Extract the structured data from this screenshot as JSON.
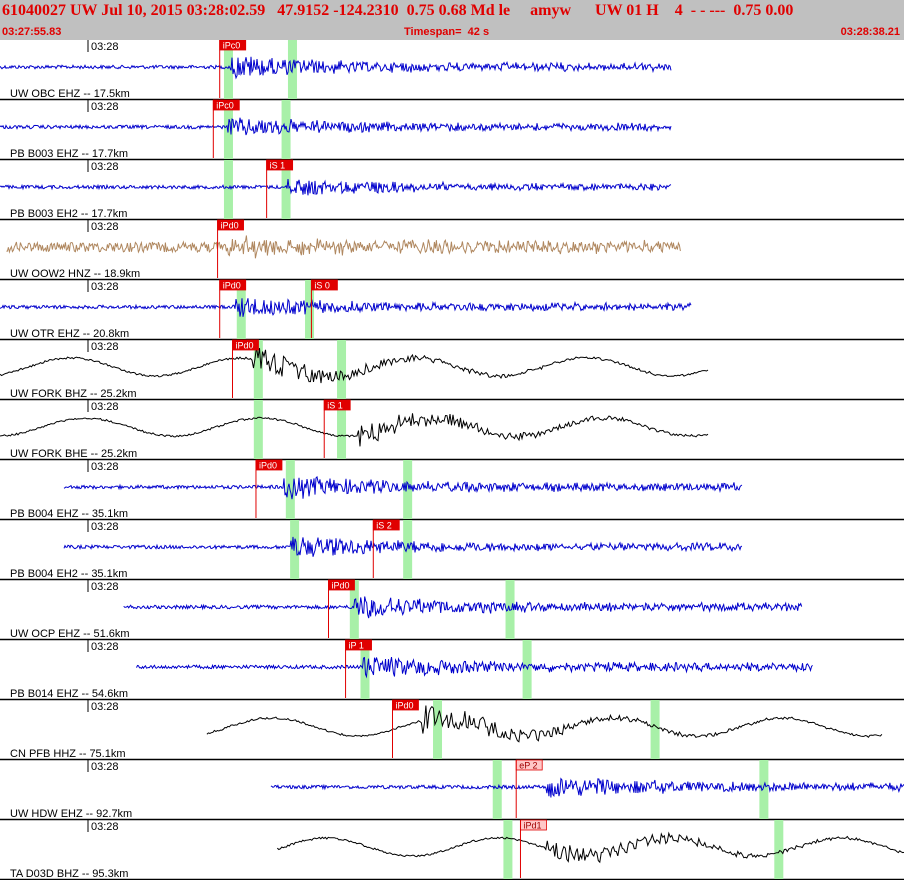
{
  "header": {
    "title": "61040027 UW Jul 10, 2015 03:28:02.59   47.9152 -124.2310  0.75 0.68 Md le     amyw      UW 01 H    4  - - ---  0.75 0.00",
    "start_time": "03:27:55.83",
    "timespan": "Timespan=  42 s",
    "end_time": "03:28:38.21"
  },
  "colors": {
    "header_bg": "#c0c0c0",
    "header_text": "#e00000",
    "blue_trace": "#0000cc",
    "tan_trace": "#b08860",
    "black_trace": "#000000",
    "pick": "#e00000",
    "pick_weak": "#ffc8c8",
    "window": "#a8f0a8"
  },
  "chart_data": {
    "type": "seismogram",
    "x_start": "03:27:55.83",
    "x_end": "03:28:38.21",
    "timespan_s": 42,
    "channels": [
      {
        "label": "UW OBC EHZ -- 17.5km",
        "time_label": "03:28",
        "color": "blue",
        "start_s": 0.0,
        "end_s": 31.5,
        "amp": 0.45,
        "picks": [
          {
            "label": "iPc0",
            "t": 10.3
          }
        ],
        "windows": [
          {
            "t": 10.5
          },
          {
            "t": 13.5
          }
        ],
        "onset_s": 10.8
      },
      {
        "label": "PB B003 EHZ -- 17.7km",
        "time_label": "03:28",
        "color": "blue",
        "start_s": 0.0,
        "end_s": 31.5,
        "amp": 0.4,
        "picks": [
          {
            "label": "iPc0",
            "t": 10.0
          }
        ],
        "windows": [
          {
            "t": 10.5
          },
          {
            "t": 13.2
          }
        ],
        "onset_s": 10.6
      },
      {
        "label": "PB B003 EH2 -- 17.7km",
        "time_label": "03:28",
        "color": "blue",
        "start_s": 0.0,
        "end_s": 31.5,
        "amp": 0.35,
        "picks": [
          {
            "label": "iS 1",
            "t": 12.5
          }
        ],
        "windows": [
          {
            "t": 10.5
          },
          {
            "t": 13.2
          }
        ],
        "onset_s": 13.5
      },
      {
        "label": "UW OOW2 HNZ -- 18.9km",
        "time_label": "03:28",
        "color": "tan",
        "start_s": 0.3,
        "end_s": 31.9,
        "amp": 0.35,
        "picks": [
          {
            "label": "iPd0",
            "t": 10.2
          }
        ],
        "windows": [],
        "onset_s": 10.7
      },
      {
        "label": "UW OTR EHZ -- 20.8km",
        "time_label": "03:28",
        "color": "blue",
        "start_s": 0.0,
        "end_s": 32.4,
        "amp": 0.4,
        "picks": [
          {
            "label": "iPd0",
            "t": 10.3
          },
          {
            "label": "iS 0",
            "t": 14.6
          }
        ],
        "windows": [
          {
            "t": 11.1
          },
          {
            "t": 14.3
          }
        ],
        "onset_s": 11.0
      },
      {
        "label": "UW FORK BHZ -- 25.2km",
        "time_label": "03:28",
        "color": "black",
        "start_s": 0.0,
        "end_s": 33.2,
        "amp": 0.5,
        "picks": [
          {
            "label": "iPd0",
            "t": 10.9
          }
        ],
        "windows": [
          {
            "t": 11.9
          },
          {
            "t": 15.8
          }
        ],
        "onset_s": 11.8
      },
      {
        "label": "UW FORK BHE -- 25.2km",
        "time_label": "03:28",
        "color": "black",
        "start_s": 0.0,
        "end_s": 33.2,
        "amp": 0.5,
        "picks": [
          {
            "label": "iS 1",
            "t": 15.2
          }
        ],
        "windows": [
          {
            "t": 11.9
          },
          {
            "t": 15.8
          }
        ],
        "onset_s": 16.8
      },
      {
        "label": "PB B004 EHZ -- 35.1km",
        "time_label": "03:28",
        "color": "blue",
        "start_s": 3.0,
        "end_s": 34.8,
        "amp": 0.45,
        "picks": [
          {
            "label": "iPd0",
            "t": 12.0
          }
        ],
        "windows": [
          {
            "t": 13.4
          },
          {
            "t": 18.9
          }
        ],
        "onset_s": 13.3
      },
      {
        "label": "PB B004 EH2 -- 35.1km",
        "time_label": "03:28",
        "color": "blue",
        "start_s": 3.0,
        "end_s": 34.8,
        "amp": 0.45,
        "picks": [
          {
            "label": "iS 2",
            "t": 17.5
          }
        ],
        "windows": [
          {
            "t": 13.6
          },
          {
            "t": 18.9
          }
        ],
        "onset_s": 13.6
      },
      {
        "label": "UW OCP EHZ -- 51.6km",
        "time_label": "03:28",
        "color": "blue",
        "start_s": 5.8,
        "end_s": 37.6,
        "amp": 0.45,
        "picks": [
          {
            "label": "iPd0",
            "t": 15.4
          }
        ],
        "windows": [
          {
            "t": 16.4
          },
          {
            "t": 23.7
          }
        ],
        "onset_s": 16.6
      },
      {
        "label": "PB B014 EHZ -- 54.6km",
        "time_label": "03:28",
        "color": "blue",
        "start_s": 6.4,
        "end_s": 38.1,
        "amp": 0.45,
        "picks": [
          {
            "label": "iP 1",
            "t": 16.2
          }
        ],
        "windows": [
          {
            "t": 16.9
          },
          {
            "t": 24.5
          }
        ],
        "onset_s": 17.0
      },
      {
        "label": "CN PFB HHZ -- 75.1km",
        "time_label": "03:28",
        "color": "black",
        "start_s": 9.7,
        "end_s": 41.4,
        "amp": 0.55,
        "picks": [
          {
            "label": "iPd0",
            "t": 18.4
          }
        ],
        "windows": [
          {
            "t": 20.3
          },
          {
            "t": 30.5
          }
        ],
        "onset_s": 19.7
      },
      {
        "label": "UW HDW EHZ -- 92.7km",
        "time_label": "03:28",
        "color": "blue",
        "start_s": 12.7,
        "end_s": 44.4,
        "amp": 0.45,
        "picks": [
          {
            "label": "eP 2",
            "t": 24.2,
            "weak": true
          }
        ],
        "windows": [
          {
            "t": 23.1
          },
          {
            "t": 35.6
          }
        ],
        "onset_s": 25.6
      },
      {
        "label": "TA D03D BHZ -- 95.3km",
        "time_label": "03:28",
        "color": "black",
        "start_s": 13.0,
        "end_s": 44.7,
        "amp": 0.45,
        "picks": [
          {
            "label": "iPd1",
            "t": 24.4,
            "weak": true
          }
        ],
        "windows": [
          {
            "t": 23.6
          },
          {
            "t": 36.3
          }
        ],
        "onset_s": 25.6
      }
    ]
  }
}
